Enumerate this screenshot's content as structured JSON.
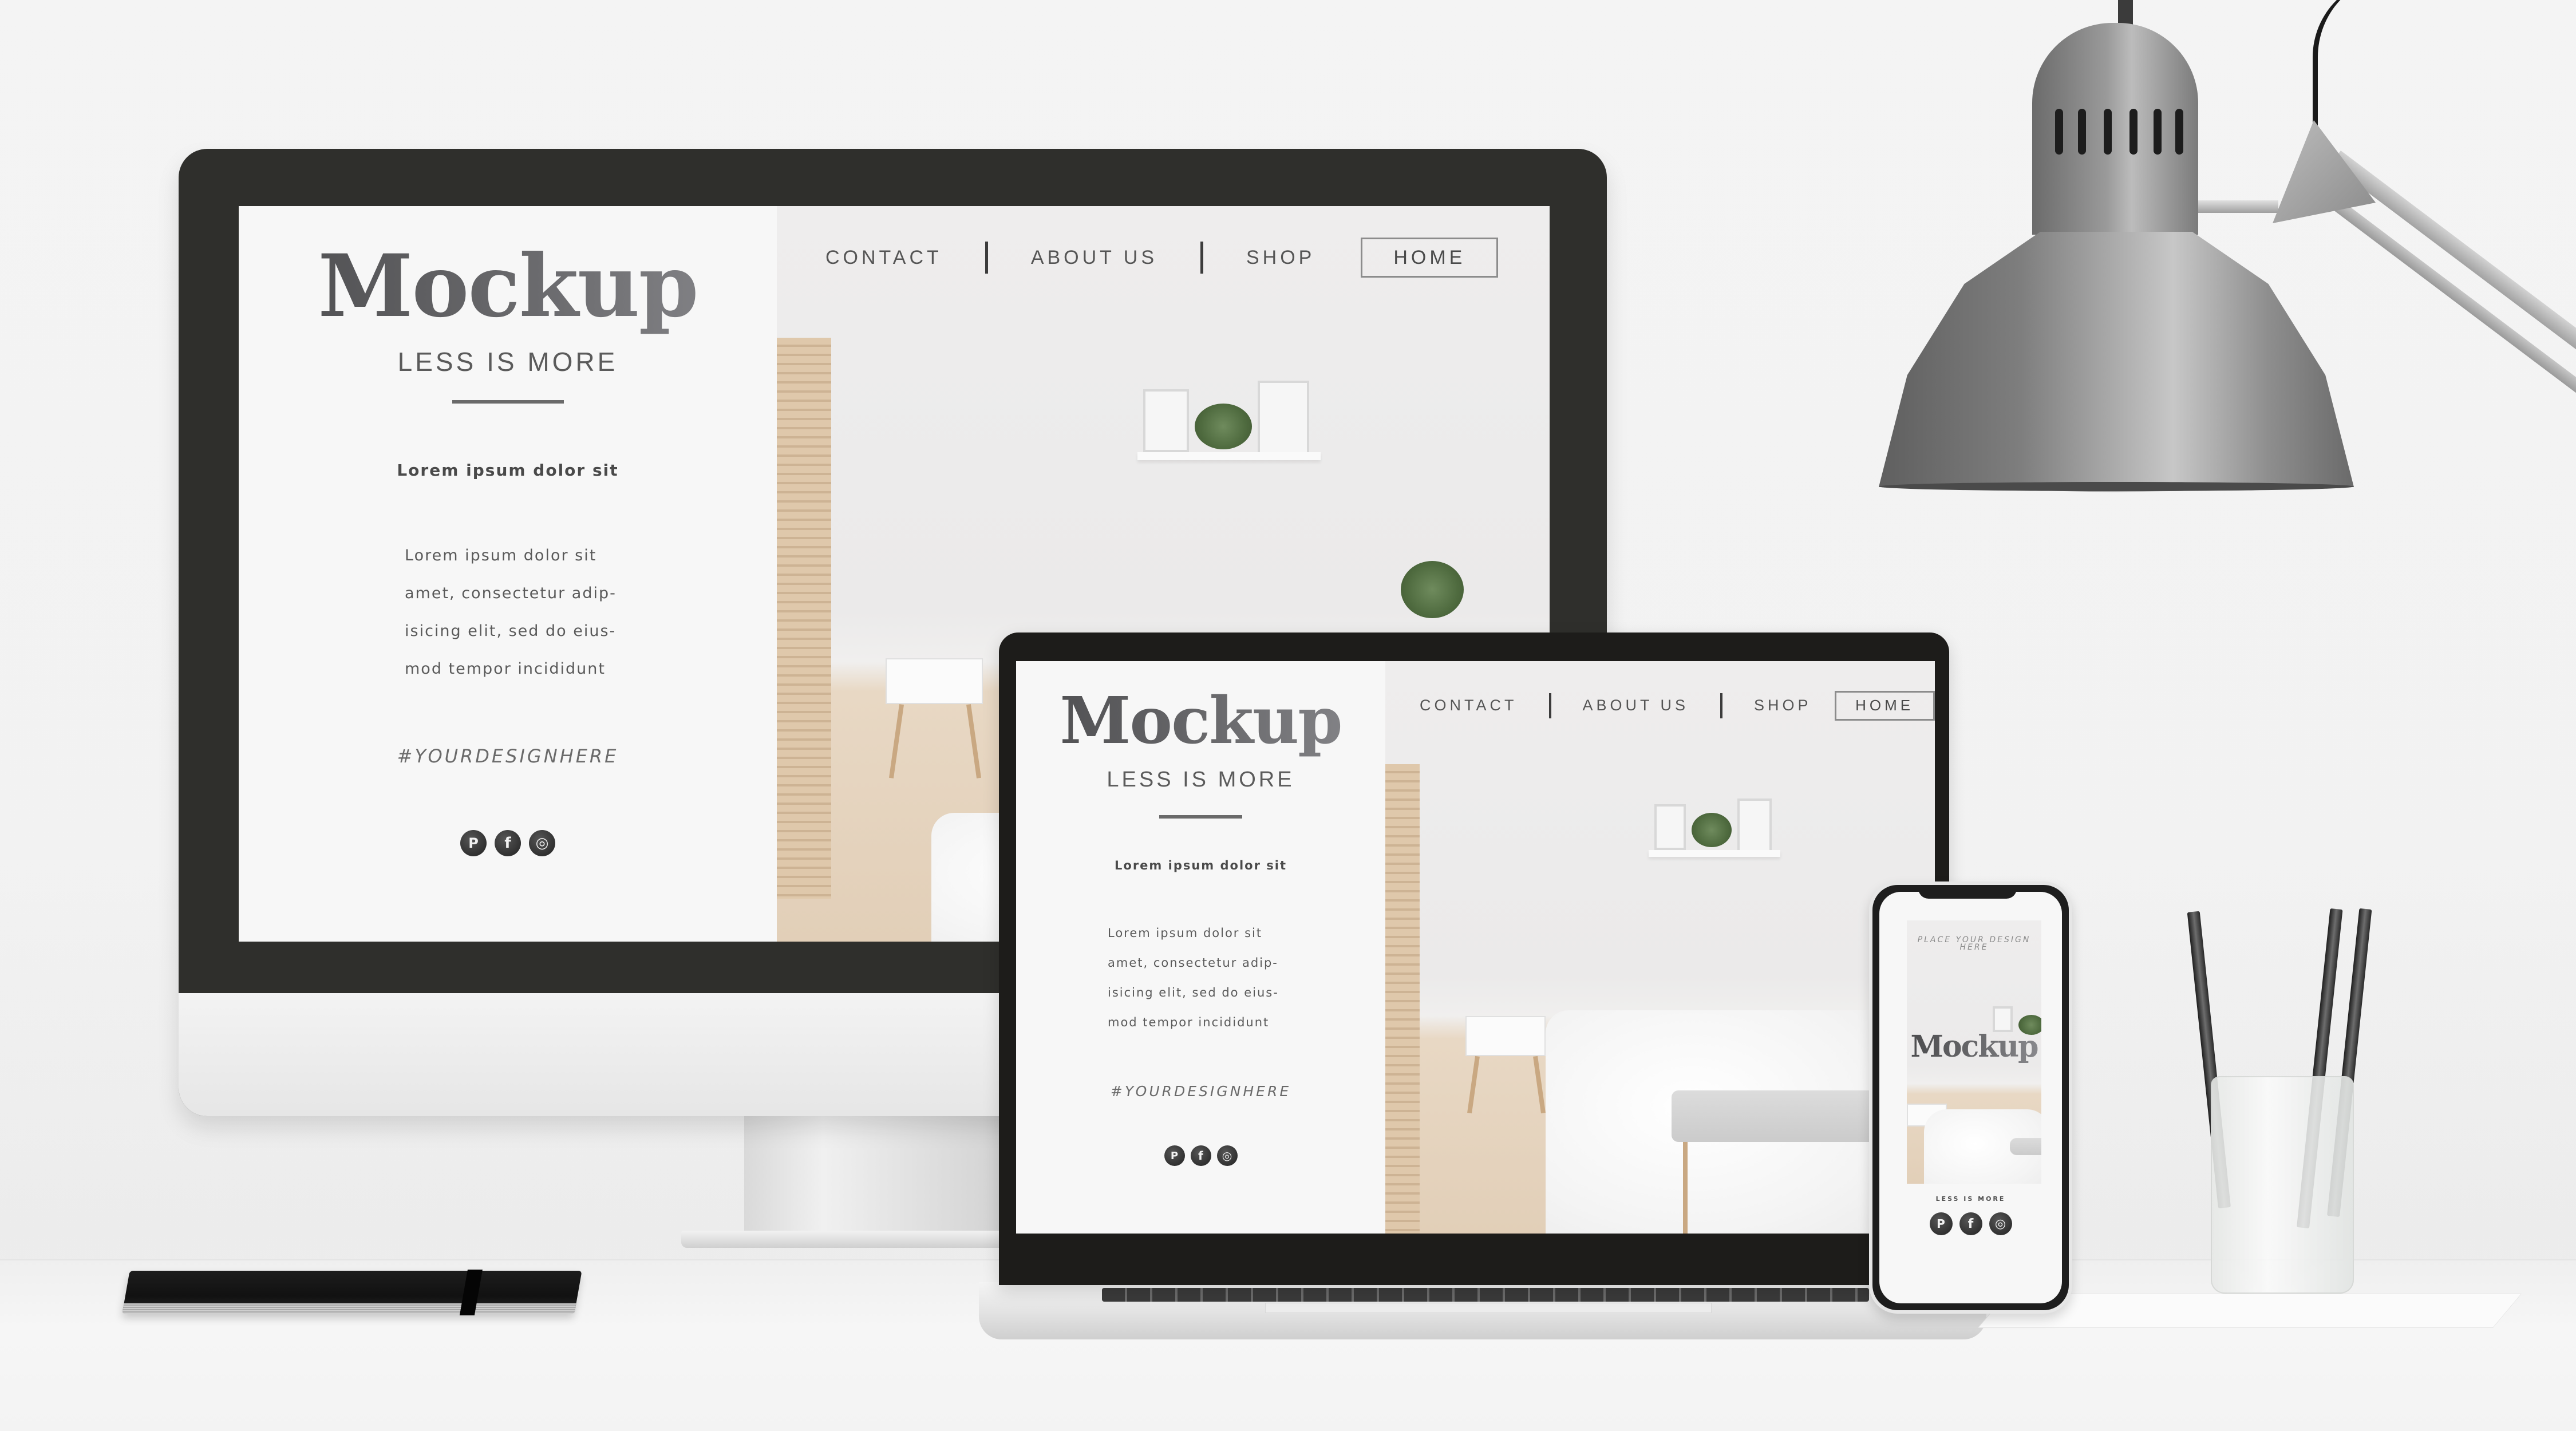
{
  "scene": {
    "description": "Responsive web design mockup on desktop, laptop and phone",
    "colors": {
      "background": "#f2f2f2",
      "bezel": "#2f2f2c",
      "text_primary": "#4a4a4a",
      "accent_wood": "#dfc8ab",
      "plant_green": "#4f6b3f"
    }
  },
  "desktop_site": {
    "brand": "Mockup",
    "tagline": "LESS IS MORE",
    "lead": "Lorem ipsum dolor sit",
    "body_lines": [
      "Lorem ipsum dolor sit",
      "amet, consectetur adip-",
      "isicing elit, sed do eius-",
      "mod tempor incididunt"
    ],
    "hashtag": "#YOURDESIGNHERE",
    "nav": [
      {
        "label": "CONTACT"
      },
      {
        "label": "ABOUT US"
      },
      {
        "label": "SHOP"
      },
      {
        "label": "HOME",
        "active": true
      }
    ],
    "socials": [
      {
        "name": "pinterest",
        "glyph": "P"
      },
      {
        "name": "facebook",
        "glyph": "f"
      },
      {
        "name": "instagram",
        "glyph": "◎"
      }
    ]
  },
  "laptop_site": {
    "brand": "Mockup",
    "tagline": "LESS IS MORE",
    "lead": "Lorem ipsum dolor sit",
    "body_lines": [
      "Lorem ipsum dolor sit",
      "amet, consectetur adip-",
      "isicing elit, sed do eius-",
      "mod tempor incididunt"
    ],
    "hashtag": "#YOURDESIGNHERE",
    "nav": [
      {
        "label": "CONTACT"
      },
      {
        "label": "ABOUT US"
      },
      {
        "label": "SHOP"
      },
      {
        "label": "HOME",
        "active": true
      }
    ],
    "socials": [
      {
        "name": "pinterest",
        "glyph": "P"
      },
      {
        "name": "facebook",
        "glyph": "f"
      },
      {
        "name": "instagram",
        "glyph": "◎"
      }
    ]
  },
  "phone_site": {
    "placeholder": "PLACE YOUR DESIGN HERE",
    "brand": "Mockup",
    "tagline": "LESS IS MORE",
    "socials": [
      {
        "name": "pinterest",
        "glyph": "P"
      },
      {
        "name": "facebook",
        "glyph": "f"
      },
      {
        "name": "instagram",
        "glyph": "◎"
      }
    ]
  }
}
